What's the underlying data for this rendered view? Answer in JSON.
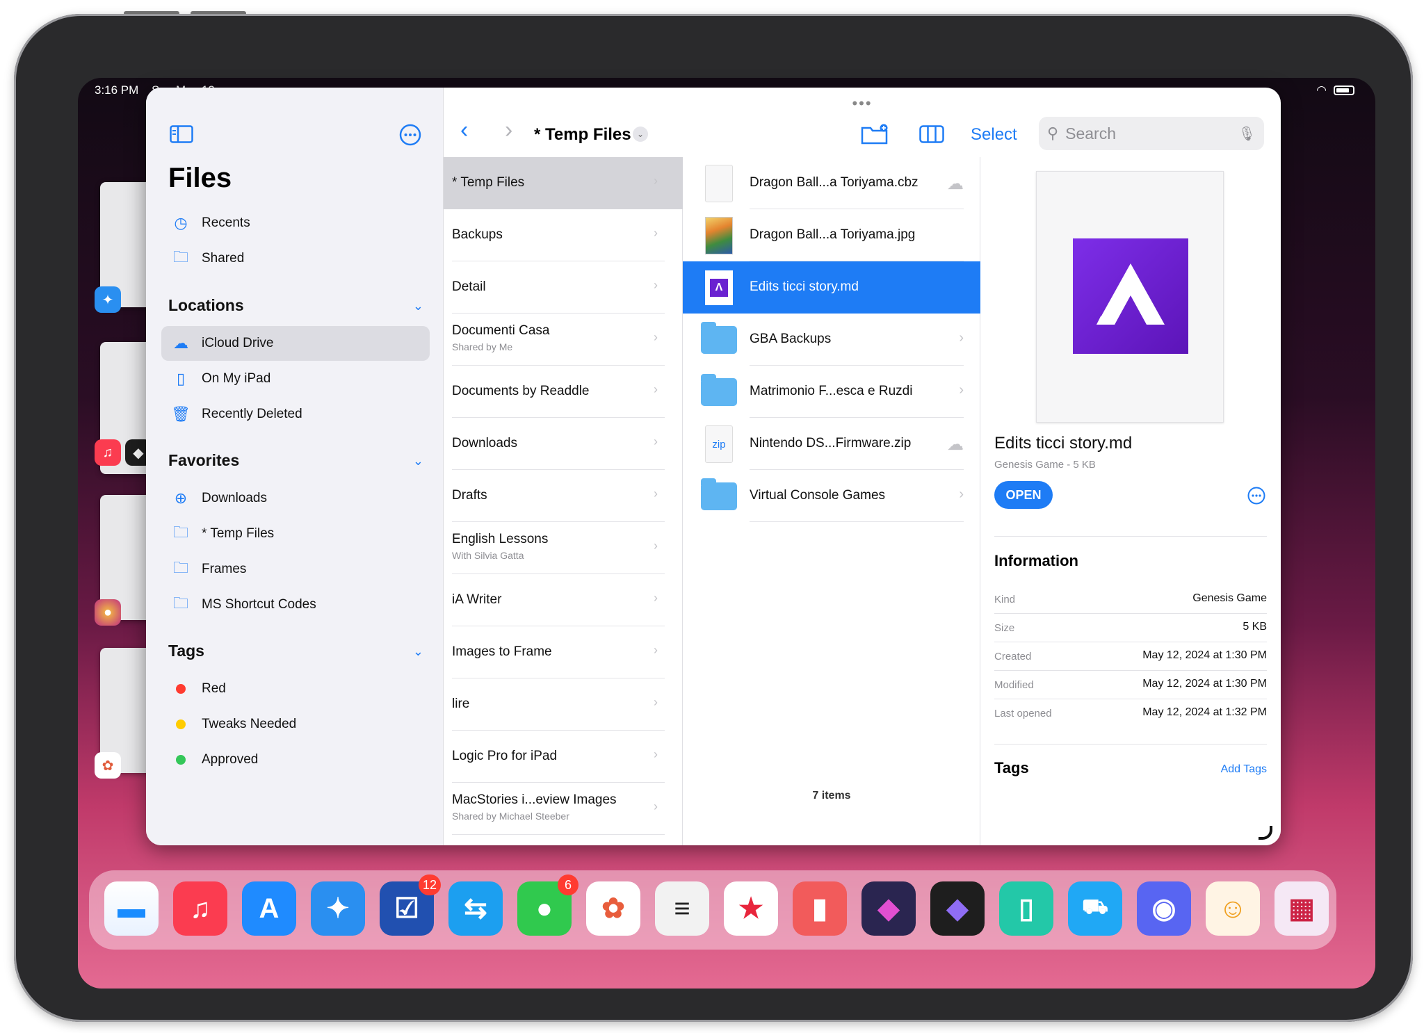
{
  "status": {
    "time": "3:16 PM",
    "date": "Sun May 12"
  },
  "sidebar": {
    "title": "Files",
    "top": [
      {
        "label": "Recents",
        "icon": "clock-icon"
      },
      {
        "label": "Shared",
        "icon": "shared-folder-icon"
      }
    ],
    "locations_header": "Locations",
    "locations": [
      {
        "label": "iCloud Drive",
        "icon": "cloud-icon",
        "selected": true
      },
      {
        "label": "On My iPad",
        "icon": "ipad-icon"
      },
      {
        "label": "Recently Deleted",
        "icon": "trash-icon"
      }
    ],
    "favorites_header": "Favorites",
    "favorites": [
      {
        "label": "Downloads",
        "icon": "download-icon"
      },
      {
        "label": "* Temp Files",
        "icon": "folder-icon"
      },
      {
        "label": "Frames",
        "icon": "folder-icon"
      },
      {
        "label": "MS Shortcut Codes",
        "icon": "folder-icon"
      }
    ],
    "tags_header": "Tags",
    "tags": [
      {
        "label": "Red",
        "color": "#ff3b30"
      },
      {
        "label": "Tweaks Needed",
        "color": "#ffcc00"
      },
      {
        "label": "Approved",
        "color": "#34c759"
      }
    ]
  },
  "toolbar": {
    "title": "* Temp Files",
    "select_label": "Select",
    "search_placeholder": "Search"
  },
  "column1": [
    {
      "title": "* Temp Files",
      "subtitle": "",
      "selected": true
    },
    {
      "title": "Backups",
      "subtitle": ""
    },
    {
      "title": "Detail",
      "subtitle": ""
    },
    {
      "title": "Documenti Casa",
      "subtitle": "Shared by Me"
    },
    {
      "title": "Documents by Readdle",
      "subtitle": ""
    },
    {
      "title": "Downloads",
      "subtitle": ""
    },
    {
      "title": "Drafts",
      "subtitle": ""
    },
    {
      "title": "English Lessons",
      "subtitle": "With Silvia Gatta"
    },
    {
      "title": "iA Writer",
      "subtitle": ""
    },
    {
      "title": "Images to Frame",
      "subtitle": ""
    },
    {
      "title": "lire",
      "subtitle": ""
    },
    {
      "title": "Logic Pro for iPad",
      "subtitle": ""
    },
    {
      "title": "MacStories i...eview Images",
      "subtitle": "Shared by Michael Steeber"
    }
  ],
  "column2": {
    "items": [
      {
        "name": "Dragon Ball...a Toriyama.cbz",
        "kind": "doc",
        "trailing": "cloud"
      },
      {
        "name": "Dragon Ball...a Toriyama.jpg",
        "kind": "image",
        "trailing": ""
      },
      {
        "name": "Edits ticci story.md",
        "kind": "genesis",
        "trailing": "",
        "selected": true
      },
      {
        "name": "GBA Backups",
        "kind": "folder",
        "trailing": "chevron"
      },
      {
        "name": "Matrimonio F...esca e Ruzdi",
        "kind": "folder",
        "trailing": "chevron"
      },
      {
        "name": "Nintendo DS...Firmware.zip",
        "kind": "zip",
        "trailing": "cloud"
      },
      {
        "name": "Virtual Console Games",
        "kind": "folder",
        "trailing": "chevron"
      }
    ],
    "count_label": "7 items",
    "zip_label": "zip"
  },
  "preview": {
    "filename": "Edits ticci story.md",
    "meta": "Genesis Game - 5 KB",
    "open_label": "OPEN",
    "info_header": "Information",
    "info": [
      {
        "key": "Kind",
        "value": "Genesis Game"
      },
      {
        "key": "Size",
        "value": "5 KB"
      },
      {
        "key": "Created",
        "value": "May 12, 2024 at 1:30 PM"
      },
      {
        "key": "Modified",
        "value": "May 12, 2024 at 1:30 PM"
      },
      {
        "key": "Last opened",
        "value": "May 12, 2024 at 1:32 PM"
      }
    ],
    "tags_header": "Tags",
    "add_tags_label": "Add Tags"
  },
  "dock": [
    {
      "name": "files-app",
      "color": "#1a8cff",
      "glyph": "▬"
    },
    {
      "name": "music-app",
      "color": "#fb3c50",
      "glyph": "♫"
    },
    {
      "name": "app-store-app",
      "color": "#1f8bff",
      "glyph": "A"
    },
    {
      "name": "safari-app",
      "color": "#2a8ff0",
      "glyph": "✦"
    },
    {
      "name": "things-app",
      "color": "#2150b0",
      "glyph": "☑",
      "badge": "12"
    },
    {
      "name": "sync-app",
      "color": "#1c9ff0",
      "glyph": "⇆"
    },
    {
      "name": "messages-app",
      "color": "#30c94e",
      "glyph": "●",
      "badge": "6"
    },
    {
      "name": "photos-app",
      "color": "#ffffff",
      "glyph": "✿"
    },
    {
      "name": "notes-lines-app",
      "color": "#f2f2f2",
      "glyph": "≡"
    },
    {
      "name": "goodlinks-app",
      "color": "#ffffff",
      "glyph": "★"
    },
    {
      "name": "bookmarks-app",
      "color": "#f25b5b",
      "glyph": "▮"
    },
    {
      "name": "shortcuts-app",
      "color": "#2a2550",
      "glyph": "◆"
    },
    {
      "name": "obsidian-app",
      "color": "#1e1e1e",
      "glyph": "◆"
    },
    {
      "name": "ipad-mirror-app",
      "color": "#23c8a8",
      "glyph": "▯"
    },
    {
      "name": "carplay-app",
      "color": "#20a8f5",
      "glyph": "🚗"
    },
    {
      "name": "discord-app",
      "color": "#5865f2",
      "glyph": "◉"
    },
    {
      "name": "chat-app",
      "color": "#fff4e4",
      "glyph": "☺"
    },
    {
      "name": "app-library",
      "color": "#f5e8f5",
      "glyph": "▦"
    }
  ]
}
